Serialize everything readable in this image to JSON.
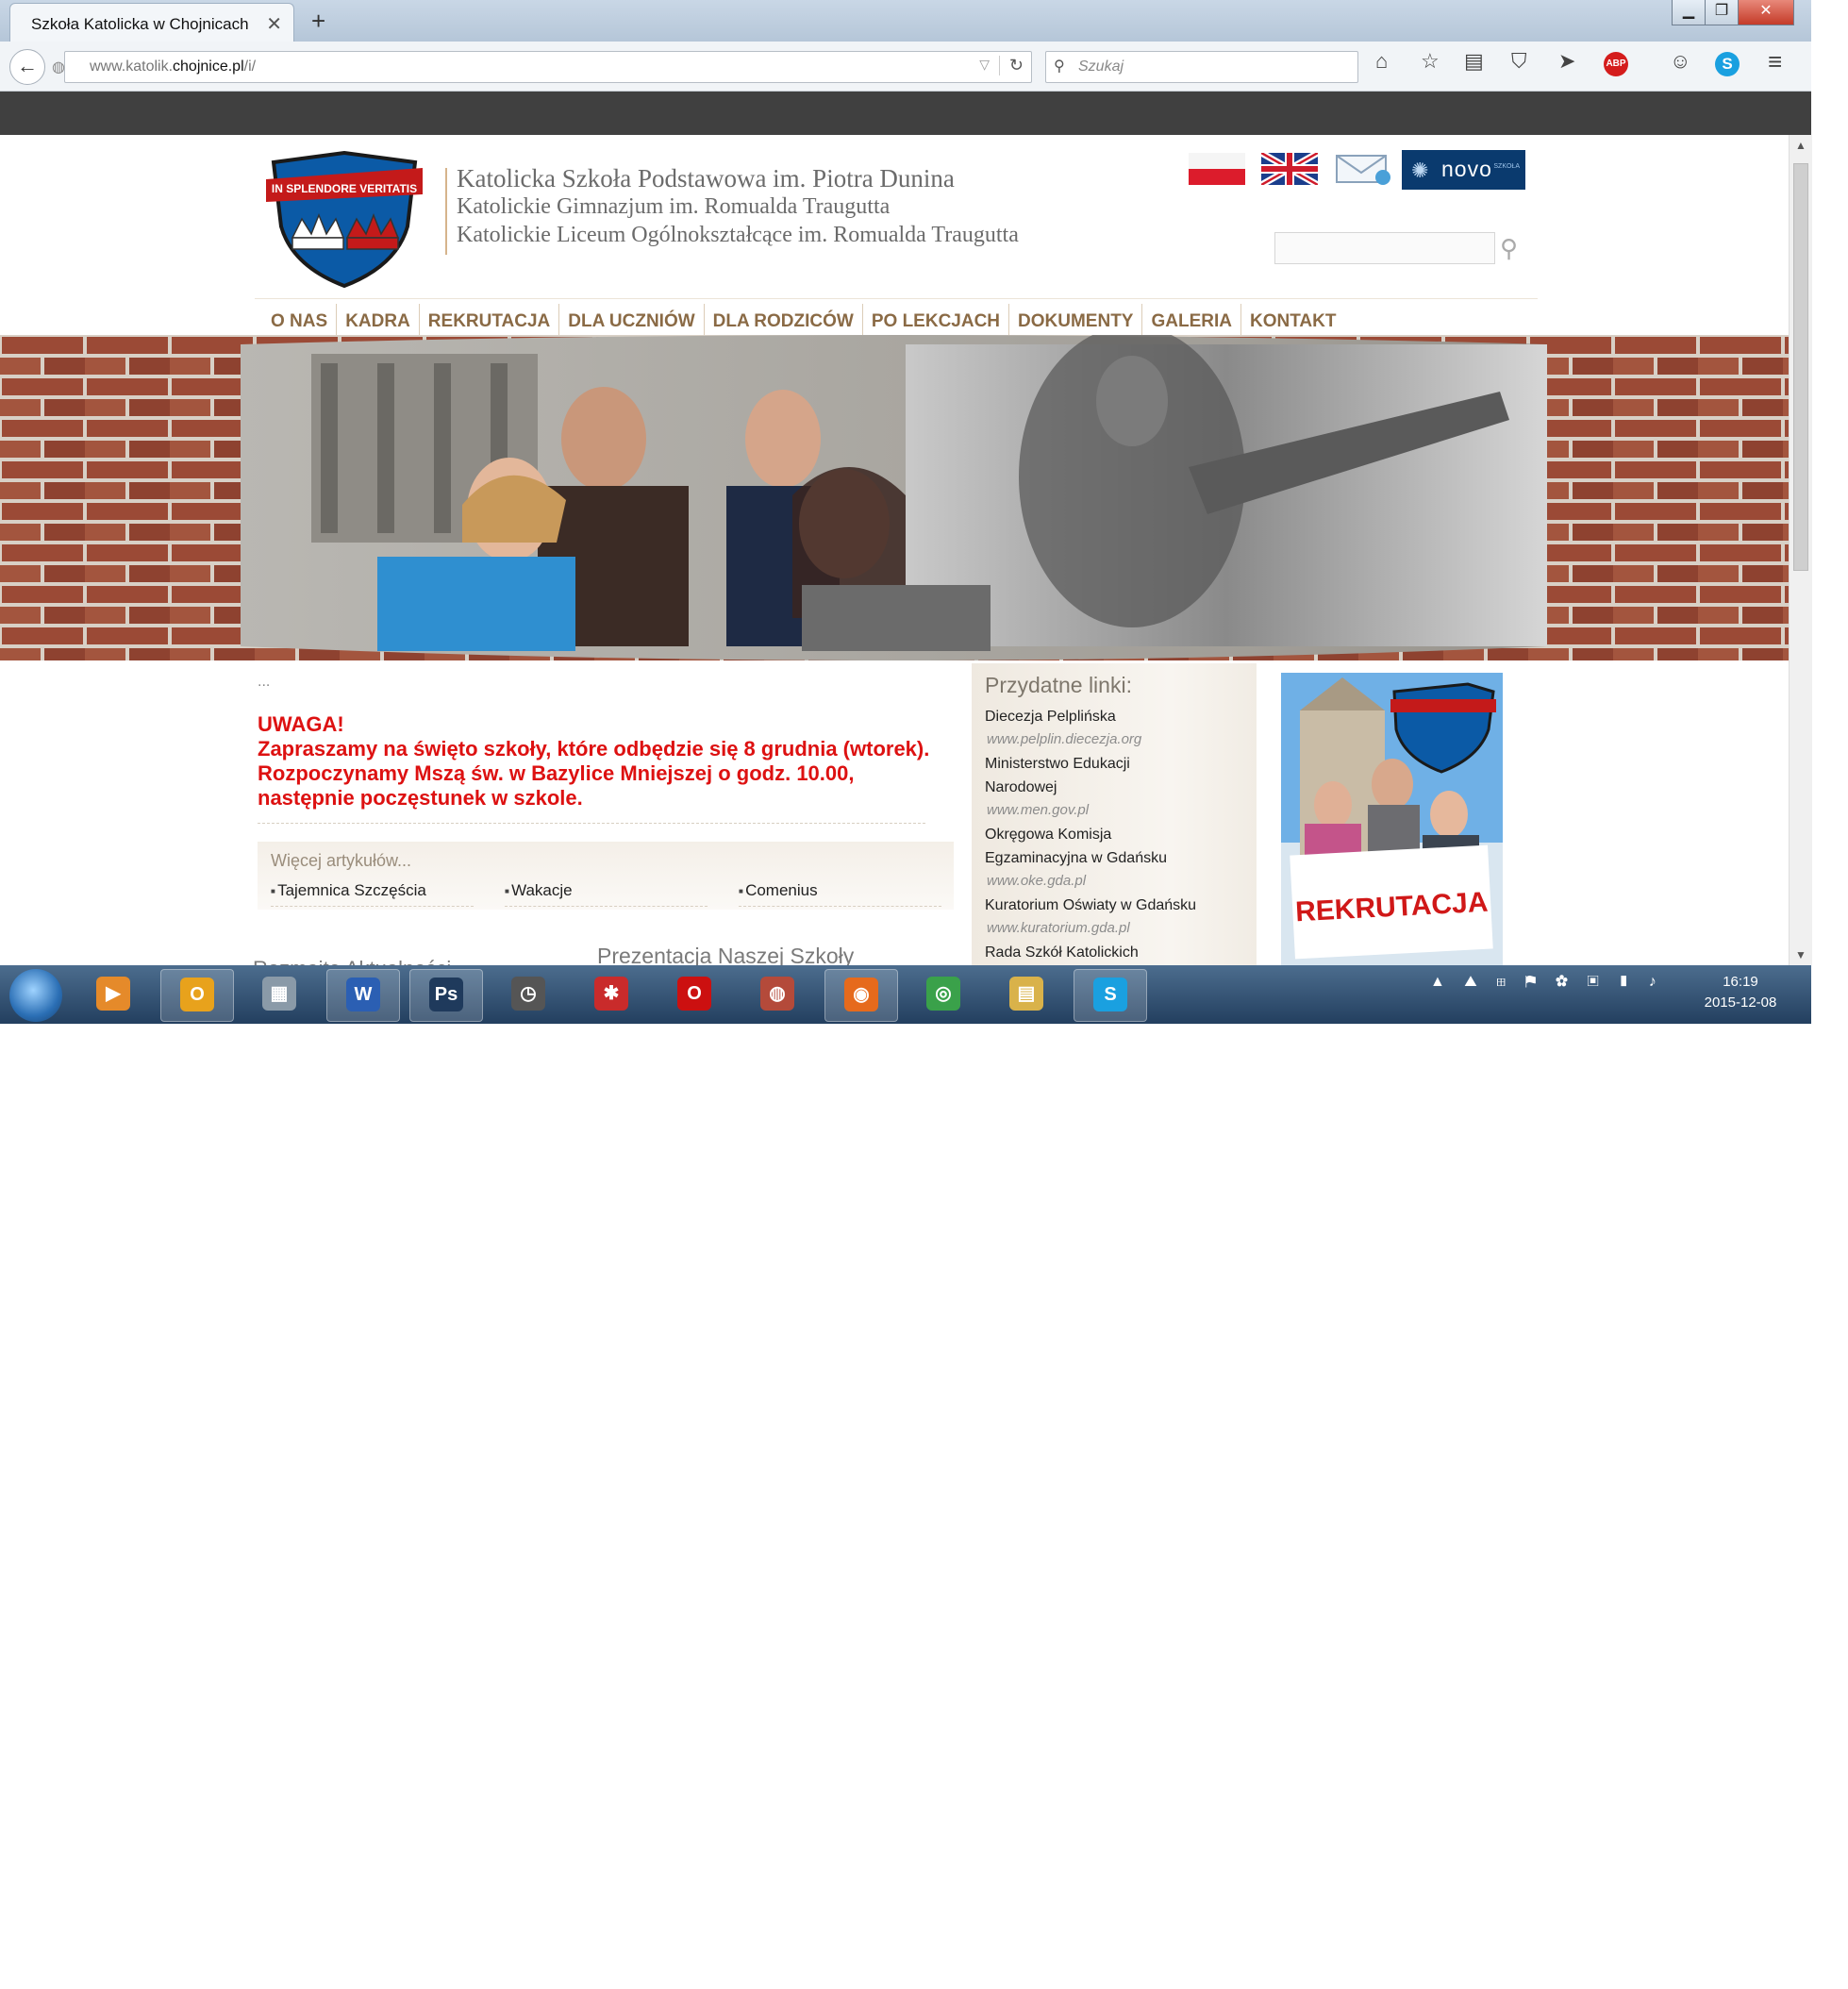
{
  "browser": {
    "tab_title": "Szkoła Katolicka w Chojnicach",
    "url_plain": "www.katolik.",
    "url_bold": "chojnice.pl",
    "url_rest": "/i/",
    "search_placeholder": "Szukaj",
    "icons": [
      "back-icon",
      "home-icon",
      "star-icon",
      "reading-list-icon",
      "pocket-icon",
      "send-icon",
      "adblock-icon",
      "chat-icon",
      "skype-icon",
      "menu-icon"
    ]
  },
  "site": {
    "header": {
      "line1": "Katolicka Szkoła Podstawowa im. Piotra Dunina",
      "line2": "Katolickie Gimnazjum im. Romualda Traugutta",
      "line3": "Katolickie Liceum Ogólnokształcące im. Romualda Traugutta",
      "logo_motto": "IN SPLENDORE VERITATIS",
      "novo_label": "novo",
      "novo_sub": "SZKOŁA"
    },
    "menu": [
      "O NAS",
      "KADRA",
      "REKRUTACJA",
      "DLA UCZNIÓW",
      "DLA RODZICÓW",
      "PO LEKCJACH",
      "DOKUMENTY",
      "GALERIA",
      "KONTAKT"
    ],
    "notice": {
      "dots": "...",
      "title": "UWAGA!",
      "body": "Zapraszamy na święto szkoły, które odbędzie się 8 grudnia (wtorek). Rozpoczynamy Mszą św. w Bazylice Mniejszej o godz. 10.00, następnie poczęstunek w szkole."
    },
    "more": {
      "heading": "Więcej artykułów...",
      "articles": [
        "Tajemnica Szczęścia",
        "Wakacje",
        "Comenius"
      ]
    },
    "presentation": "Prezentacja Naszej Szkoły",
    "aktualnosci": "Rozmaite Aktualności",
    "links": {
      "heading": "Przydatne linki:",
      "items": [
        {
          "name": "Diecezja Pelplińska",
          "url": "www.pelplin.diecezja.org"
        },
        {
          "name": "Ministerstwo Edukacji",
          "name2": "Narodowej",
          "url": "www.men.gov.pl"
        },
        {
          "name": "Okręgowa Komisja",
          "name2": "Egzaminacyjna w Gdańsku",
          "url": "www.oke.gda.pl"
        },
        {
          "name": "Kuratorium Oświaty w Gdańsku",
          "url": "www.kuratorium.gda.pl"
        },
        {
          "name": "Rada Szkół Katolickich"
        }
      ]
    },
    "rekrutacja_label": "REKRUTACJA"
  },
  "taskbar": {
    "time": "16:19",
    "date": "2015-12-08",
    "apps": [
      {
        "name": "media-player",
        "glyph": "▶",
        "color": "#e58a2a"
      },
      {
        "name": "outlook",
        "glyph": "O",
        "color": "#e8a21c"
      },
      {
        "name": "archive",
        "glyph": "▦",
        "color": "#8a9aa8"
      },
      {
        "name": "word",
        "glyph": "W",
        "color": "#2b5fb3"
      },
      {
        "name": "photoshop",
        "glyph": "Ps",
        "color": "#1f3a5c"
      },
      {
        "name": "clock-app",
        "glyph": "◷",
        "color": "#555"
      },
      {
        "name": "tool-app",
        "glyph": "✱",
        "color": "#c92b2b"
      },
      {
        "name": "opera",
        "glyph": "O",
        "color": "#cc1010"
      },
      {
        "name": "globe-app",
        "glyph": "◍",
        "color": "#b44a3a"
      },
      {
        "name": "firefox",
        "glyph": "◉",
        "color": "#e66a1c"
      },
      {
        "name": "chrome",
        "glyph": "◎",
        "color": "#3aa14a"
      },
      {
        "name": "explorer",
        "glyph": "▤",
        "color": "#d9b24a"
      },
      {
        "name": "skype",
        "glyph": "S",
        "color": "#1aa0e0"
      }
    ]
  },
  "colors": {
    "menu": "#8a6a45",
    "notice": "#dd1111",
    "novo_bg": "#0a3a6e"
  }
}
